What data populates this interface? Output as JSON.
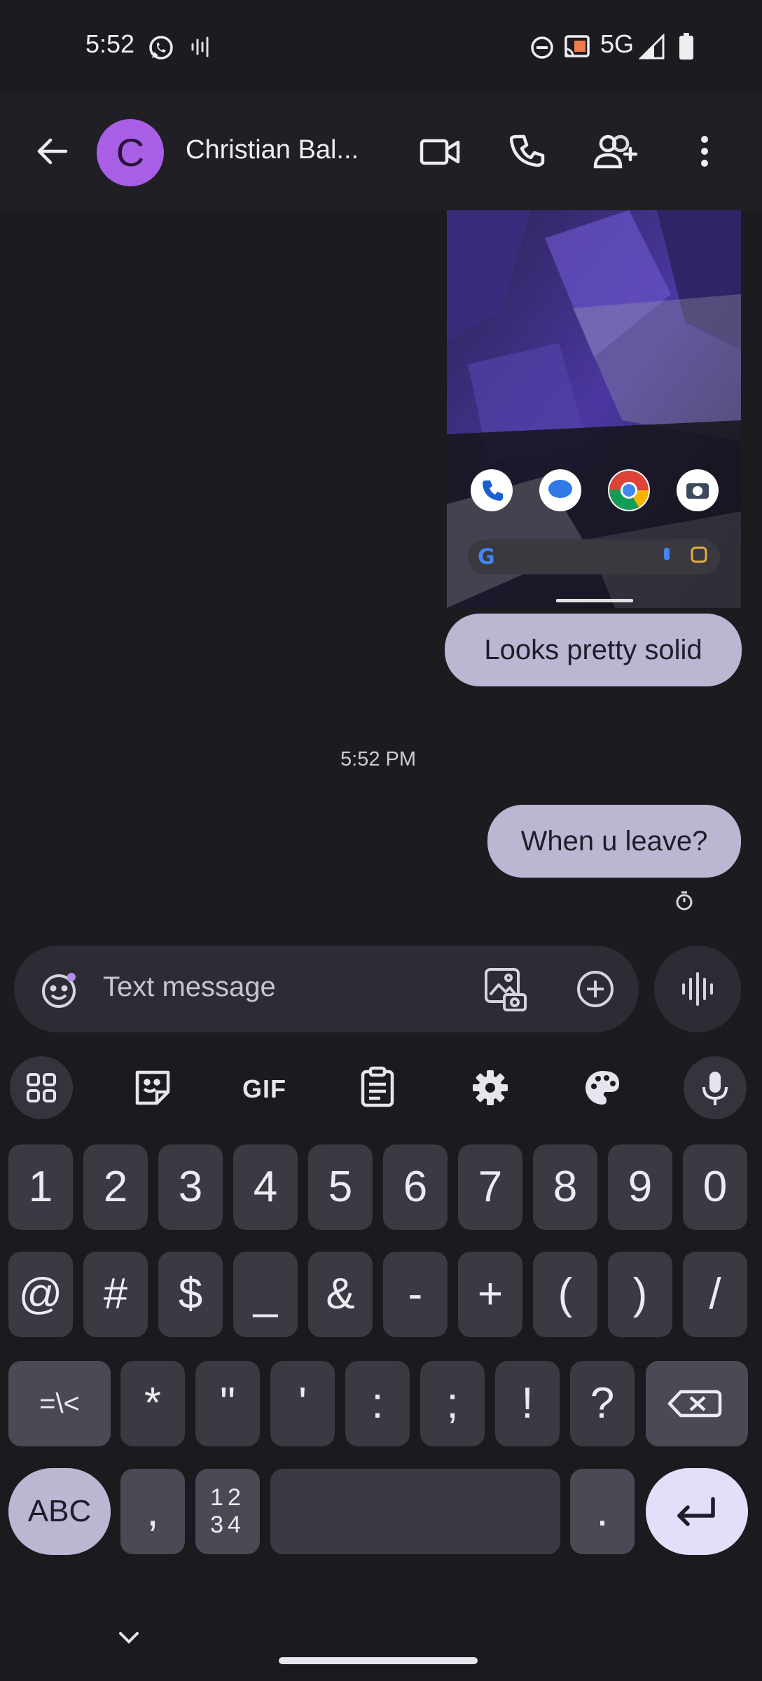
{
  "status_bar": {
    "time": "5:52",
    "network": "5G"
  },
  "header": {
    "avatar_letter": "C",
    "contact_name": "Christian Bal..."
  },
  "conversation": {
    "messages": [
      {
        "text": "Looks pretty solid"
      },
      {
        "text": "When u leave?"
      }
    ],
    "timestamp": "5:52 PM"
  },
  "compose": {
    "placeholder": "Text message"
  },
  "keyboard": {
    "toolbar": {
      "gif_label": "GIF"
    },
    "row1": [
      "1",
      "2",
      "3",
      "4",
      "5",
      "6",
      "7",
      "8",
      "9",
      "0"
    ],
    "row2": [
      "@",
      "#",
      "$",
      "_",
      "&",
      "-",
      "+",
      "(",
      ")",
      "/"
    ],
    "row3": [
      "=\\<",
      "*",
      "\"",
      "'",
      ":",
      ";",
      "!",
      "?"
    ],
    "row4": {
      "abc": "ABC",
      "comma": ",",
      "numpad_top": "12",
      "numpad_bottom": "34",
      "period": "."
    }
  },
  "colors": {
    "background": "#1b1b20",
    "accent_avatar": "#a85fe6",
    "bubble": "#bdb6d3",
    "enter_key": "#e5defa"
  }
}
